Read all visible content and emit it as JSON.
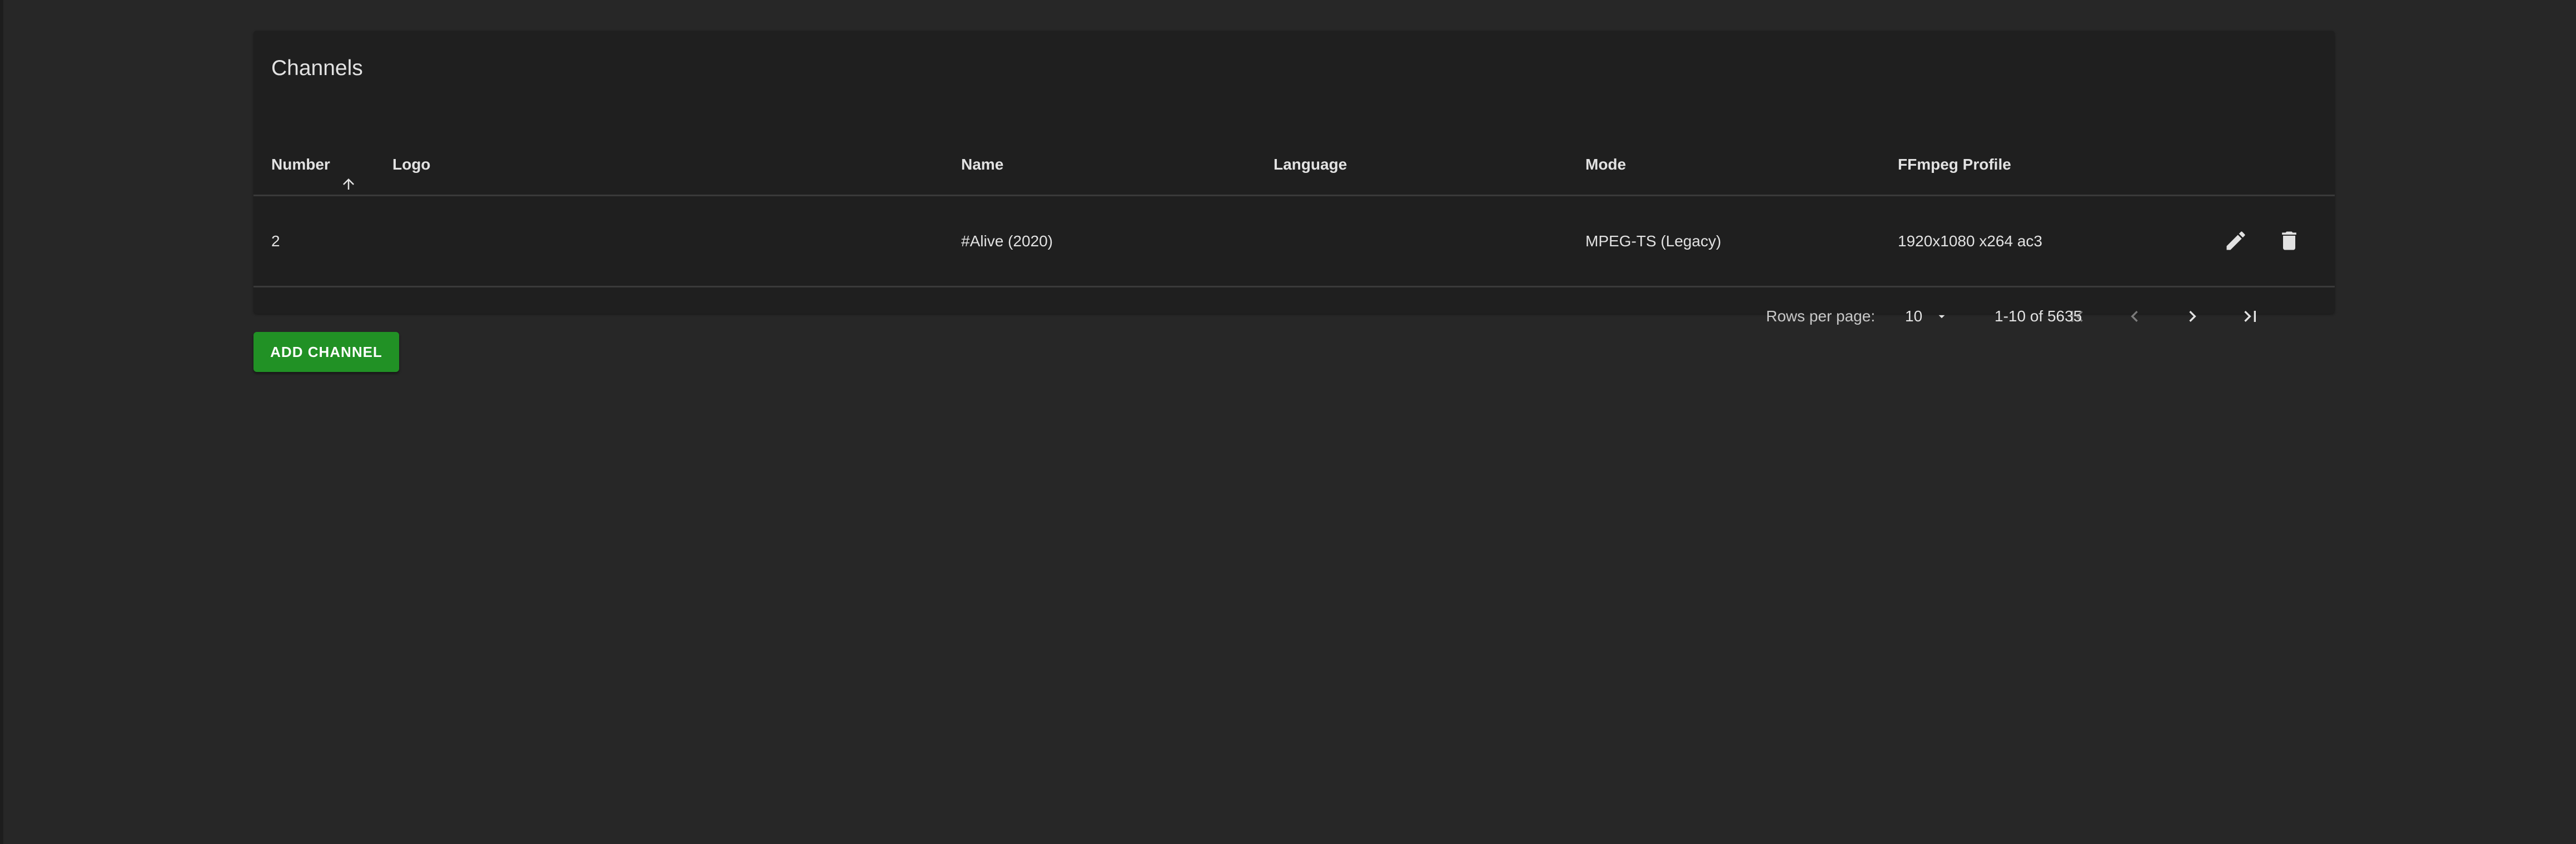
{
  "card": {
    "title": "Channels"
  },
  "table": {
    "columns": {
      "number": "Number",
      "logo": "Logo",
      "name": "Name",
      "language": "Language",
      "mode": "Mode",
      "ffmpeg_profile": "FFmpeg Profile"
    },
    "sort": {
      "column": "Number",
      "direction": "ascending",
      "icon": "arrow-up-icon"
    },
    "rows": [
      {
        "number": "2",
        "logo": "",
        "name": "#Alive (2020)",
        "language": "",
        "mode": "MPEG-TS (Legacy)",
        "ffmpeg_profile": "1920x1080 x264 ac3",
        "actions": [
          "edit-icon",
          "delete-icon"
        ]
      }
    ]
  },
  "pagination": {
    "rows_per_page_label": "Rows per page:",
    "rows_per_page_value": "10",
    "range_text": "1-10 of 5635",
    "buttons": [
      "first-page-icon",
      "previous-page-icon",
      "next-page-icon",
      "last-page-icon"
    ]
  },
  "actions": {
    "add_channel_label": "ADD CHANNEL"
  },
  "colors": {
    "background": "#272727",
    "card": "#1f1f1f",
    "divider": "#3a3a3a",
    "accent_green": "#219125",
    "text": "#dedede"
  }
}
